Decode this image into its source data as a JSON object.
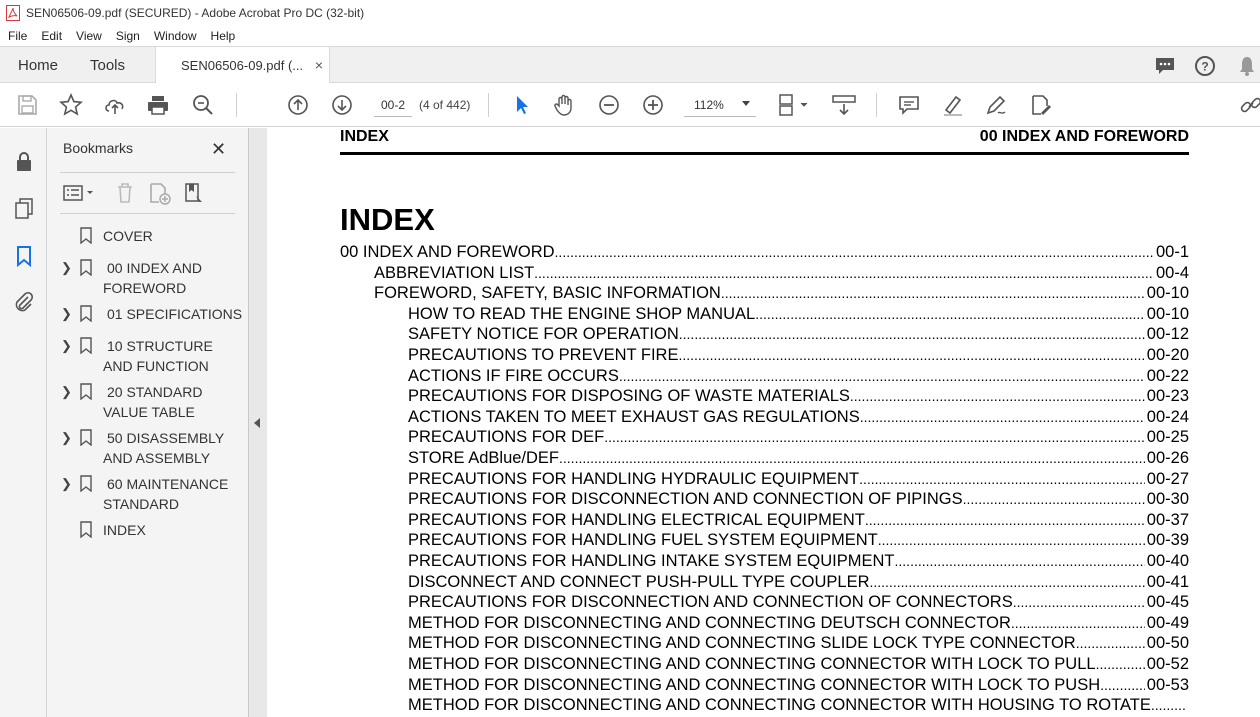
{
  "window": {
    "title": "SEN06506-09.pdf (SECURED) - Adobe Acrobat Pro DC (32-bit)"
  },
  "menu": [
    "File",
    "Edit",
    "View",
    "Sign",
    "Window",
    "Help"
  ],
  "tabs": {
    "home": "Home",
    "tools": "Tools",
    "document": "SEN06506-09.pdf (...",
    "close": "×"
  },
  "toolbar": {
    "page_value": "00-2",
    "page_count": "(4 of 442)",
    "zoom": "112%"
  },
  "bookmarks": {
    "title": "Bookmarks",
    "close": "✕",
    "items": [
      {
        "label": "COVER",
        "expandable": false
      },
      {
        "label": "00 INDEX AND FOREWORD",
        "expandable": true
      },
      {
        "label": "01 SPECIFICATIONS",
        "expandable": true
      },
      {
        "label": "10 STRUCTURE AND FUNCTION",
        "expandable": true
      },
      {
        "label": "20 STANDARD VALUE TABLE",
        "expandable": true
      },
      {
        "label": "50 DISASSEMBLY AND ASSEMBLY",
        "expandable": true
      },
      {
        "label": "60 MAINTENANCE STANDARD",
        "expandable": true
      },
      {
        "label": "INDEX",
        "expandable": false
      }
    ]
  },
  "document": {
    "header_left": "INDEX",
    "header_right": "00 INDEX AND FOREWORD",
    "title": "INDEX",
    "toc": [
      {
        "level": 0,
        "text": "00 INDEX AND FOREWORD",
        "page": "00-1"
      },
      {
        "level": 1,
        "text": "ABBREVIATION LIST",
        "page": "00-4"
      },
      {
        "level": 1,
        "text": "FOREWORD, SAFETY, BASIC INFORMATION",
        "page": "00-10"
      },
      {
        "level": 2,
        "text": "HOW TO READ THE ENGINE SHOP MANUAL",
        "page": "00-10"
      },
      {
        "level": 2,
        "text": "SAFETY NOTICE FOR OPERATION",
        "page": "00-12"
      },
      {
        "level": 2,
        "text": "PRECAUTIONS TO PREVENT FIRE",
        "page": "00-20"
      },
      {
        "level": 2,
        "text": "ACTIONS IF FIRE OCCURS",
        "page": "00-22"
      },
      {
        "level": 2,
        "text": "PRECAUTIONS FOR DISPOSING OF WASTE MATERIALS",
        "page": "00-23"
      },
      {
        "level": 2,
        "text": "ACTIONS TAKEN TO MEET EXHAUST GAS REGULATIONS",
        "page": "00-24"
      },
      {
        "level": 2,
        "text": "PRECAUTIONS FOR DEF",
        "page": "00-25"
      },
      {
        "level": 2,
        "text": "STORE AdBlue/DEF",
        "page": "00-26"
      },
      {
        "level": 2,
        "text": "PRECAUTIONS FOR HANDLING HYDRAULIC EQUIPMENT",
        "page": "00-27"
      },
      {
        "level": 2,
        "text": "PRECAUTIONS FOR DISCONNECTION AND CONNECTION OF PIPINGS",
        "page": "00-30"
      },
      {
        "level": 2,
        "text": "PRECAUTIONS FOR HANDLING ELECTRICAL EQUIPMENT",
        "page": "00-37"
      },
      {
        "level": 2,
        "text": "PRECAUTIONS FOR HANDLING FUEL SYSTEM EQUIPMENT",
        "page": "00-39"
      },
      {
        "level": 2,
        "text": "PRECAUTIONS FOR HANDLING INTAKE SYSTEM EQUIPMENT",
        "page": "00-40"
      },
      {
        "level": 2,
        "text": "DISCONNECT AND CONNECT PUSH-PULL TYPE COUPLER",
        "page": "00-41"
      },
      {
        "level": 2,
        "text": "PRECAUTIONS FOR DISCONNECTION AND CONNECTION OF CONNECTORS",
        "page": "00-45"
      },
      {
        "level": 2,
        "text": "METHOD FOR DISCONNECTING AND CONNECTING DEUTSCH CONNECTOR",
        "page": "00-49"
      },
      {
        "level": 2,
        "text": "METHOD FOR DISCONNECTING AND CONNECTING SLIDE LOCK TYPE CONNECTOR",
        "page": "00-50"
      },
      {
        "level": 2,
        "text": "METHOD FOR DISCONNECTING AND CONNECTING CONNECTOR WITH LOCK TO PULL",
        "page": "00-52"
      },
      {
        "level": 2,
        "text": "METHOD FOR DISCONNECTING AND CONNECTING CONNECTOR WITH LOCK TO PUSH",
        "page": "00-53"
      },
      {
        "level": 2,
        "text": "METHOD FOR DISCONNECTING AND CONNECTING CONNECTOR WITH HOUSING TO ROTATE",
        "page": ""
      }
    ]
  },
  "colors": {
    "accent": "#1473e6",
    "pdf_red": "#d7373f"
  }
}
